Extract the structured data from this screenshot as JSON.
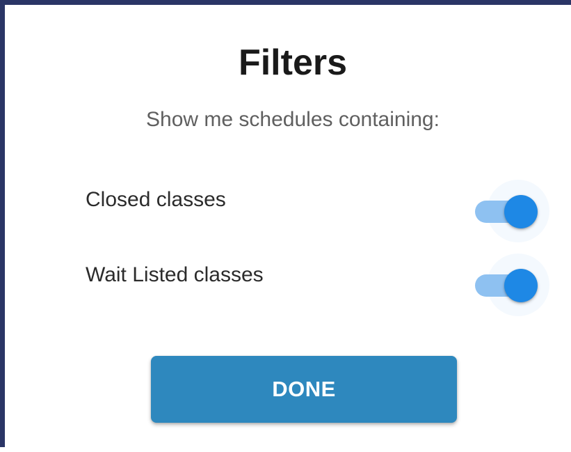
{
  "dialog": {
    "title": "Filters",
    "subtitle": "Show me schedules containing:"
  },
  "filters": [
    {
      "label": "Closed classes",
      "enabled": true
    },
    {
      "label": "Wait Listed classes",
      "enabled": true
    }
  ],
  "actions": {
    "done_label": "DONE"
  },
  "colors": {
    "accent": "#1e88e5",
    "track": "#8ec1f1",
    "button": "#2e88be",
    "frame_border": "#2a3566"
  }
}
